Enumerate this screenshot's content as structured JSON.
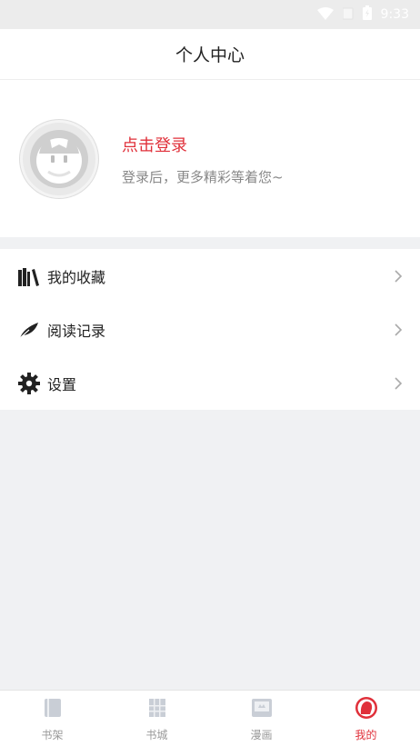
{
  "status_bar": {
    "time": "9:33"
  },
  "header": {
    "title": "个人中心"
  },
  "profile": {
    "login_title": "点击登录",
    "login_subtitle": "登录后，更多精彩等着您~"
  },
  "menu": {
    "items": [
      {
        "label": "我的收藏",
        "icon": "bookshelf-icon"
      },
      {
        "label": "阅读记录",
        "icon": "feather-icon"
      },
      {
        "label": "设置",
        "icon": "gear-icon"
      }
    ]
  },
  "tabbar": {
    "tabs": [
      {
        "label": "书架",
        "icon": "bookshelf-tab-icon"
      },
      {
        "label": "书城",
        "icon": "bookstore-tab-icon"
      },
      {
        "label": "漫画",
        "icon": "comic-tab-icon"
      },
      {
        "label": "我的",
        "icon": "profile-tab-icon",
        "active": true
      }
    ]
  },
  "colors": {
    "accent": "#e0303a",
    "background": "#f0f1f3",
    "muted_text": "#888888"
  }
}
